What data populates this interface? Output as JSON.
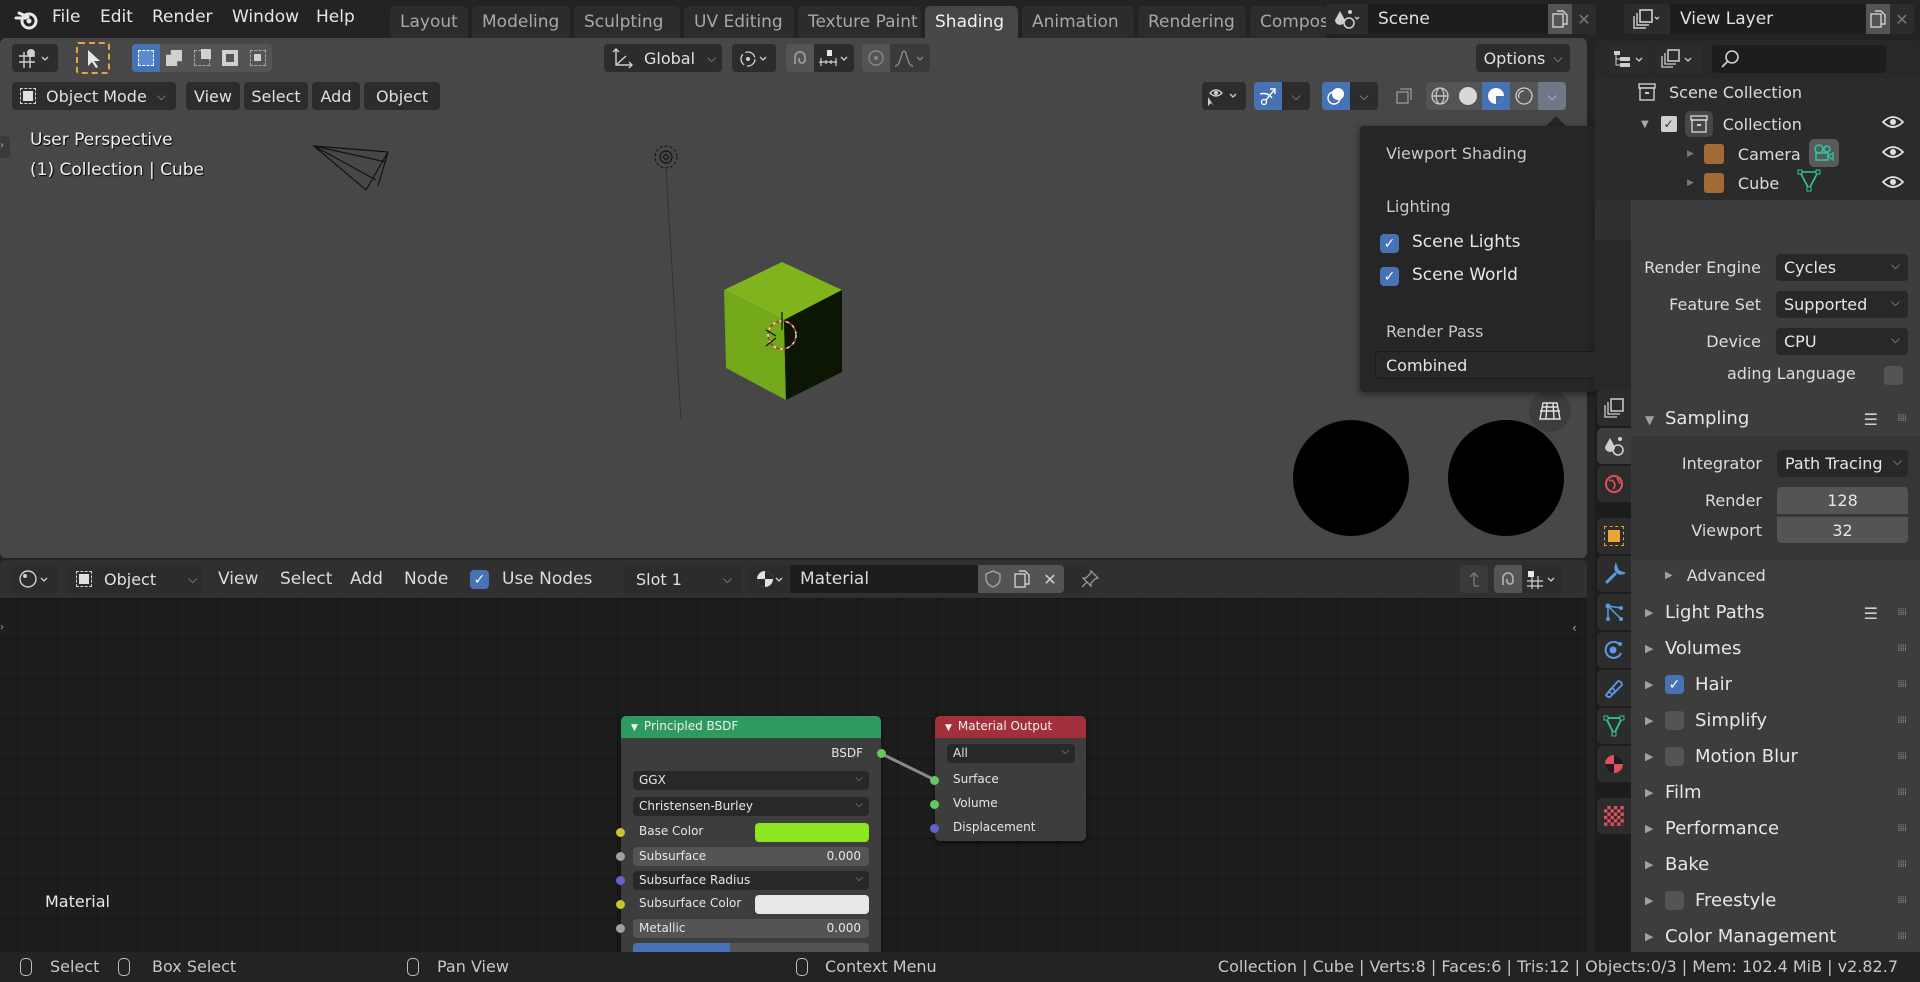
{
  "menubar": {
    "items": [
      "File",
      "Edit",
      "Render",
      "Window",
      "Help"
    ]
  },
  "workspaces": {
    "tabs": [
      "Layout",
      "Modeling",
      "Sculpting",
      "UV Editing",
      "Texture Paint",
      "Shading",
      "Animation",
      "Rendering",
      "Compos"
    ],
    "active": "Shading"
  },
  "scene_selector": {
    "icon": "scene-icon",
    "value": "Scene"
  },
  "viewlayer_selector": {
    "icon": "view-layer-icon",
    "value": "View Layer"
  },
  "tool_header": {
    "transform_orientation": "Global",
    "options_label": "Options"
  },
  "viewport_header": {
    "mode": "Object Mode",
    "menus": [
      "View",
      "Select",
      "Add",
      "Object"
    ]
  },
  "viewport": {
    "perspective_label": "User Perspective",
    "object_label": "(1) Collection | Cube",
    "cube_color": "#7fb41c"
  },
  "shading_popover": {
    "title": "Viewport Shading",
    "lighting_label": "Lighting",
    "scene_lights": {
      "label": "Scene Lights",
      "checked": true
    },
    "scene_world": {
      "label": "Scene World",
      "checked": true
    },
    "render_pass_label": "Render Pass",
    "render_pass_value": "Combined"
  },
  "node_header": {
    "editor_type": "Object",
    "menus": [
      "View",
      "Select",
      "Add",
      "Node"
    ],
    "use_nodes": {
      "label": "Use Nodes",
      "checked": true
    },
    "slot": "Slot 1",
    "material_name": "Material"
  },
  "node_editor": {
    "context_label": "Material",
    "principled": {
      "title": "Principled BSDF",
      "header_color": "#2e9a5f",
      "output": "BSDF",
      "distribution": "GGX",
      "subsurface_method": "Christensen-Burley",
      "inputs": [
        {
          "label": "Base Color",
          "type": "color",
          "color": "#8de61f"
        },
        {
          "label": "Subsurface",
          "type": "slider",
          "value": "0.000"
        },
        {
          "label": "Subsurface Radius",
          "type": "dropdown"
        },
        {
          "label": "Subsurface Color",
          "type": "color",
          "color": "#e8e8e8"
        },
        {
          "label": "Metallic",
          "type": "slider",
          "value": "0.000"
        }
      ]
    },
    "material_output": {
      "title": "Material Output",
      "header_color": "#a2303a",
      "target": "All",
      "inputs": [
        "Surface",
        "Volume",
        "Displacement"
      ]
    }
  },
  "outliner": {
    "root": "Scene Collection",
    "items": [
      {
        "label": "Collection",
        "visible": true
      },
      {
        "label": "Camera",
        "visible": true
      },
      {
        "label": "Cube",
        "visible": true
      }
    ]
  },
  "properties": {
    "context": "Scene",
    "render_engine": {
      "label": "Render Engine",
      "value": "Cycles"
    },
    "feature_set": {
      "label": "Feature Set",
      "value": "Supported"
    },
    "device": {
      "label": "Device",
      "value": "CPU"
    },
    "osl": {
      "label": "Open Shading Language",
      "visible_label": "ading Language",
      "checked": false
    },
    "sampling": {
      "title": "Sampling",
      "integrator": {
        "label": "Integrator",
        "value": "Path Tracing"
      },
      "render": {
        "label": "Render",
        "value": "128"
      },
      "viewport": {
        "label": "Viewport",
        "value": "32"
      },
      "advanced": "Advanced"
    },
    "panels": [
      {
        "title": "Light Paths",
        "checkbox": null,
        "presets": true
      },
      {
        "title": "Volumes",
        "checkbox": null
      },
      {
        "title": "Hair",
        "checkbox": true
      },
      {
        "title": "Simplify",
        "checkbox": false
      },
      {
        "title": "Motion Blur",
        "checkbox": false
      },
      {
        "title": "Film",
        "checkbox": null
      },
      {
        "title": "Performance",
        "checkbox": null
      },
      {
        "title": "Bake",
        "checkbox": null
      },
      {
        "title": "Freestyle",
        "checkbox": false
      },
      {
        "title": "Color Management",
        "checkbox": null
      }
    ]
  },
  "statusbar": {
    "hints": [
      "Select",
      "Box Select",
      "Pan View",
      "Context Menu"
    ],
    "info": "Collection | Cube | Verts:8 | Faces:6 | Tris:12 | Objects:0/3 | Mem: 102.4 MiB | v2.82.7"
  }
}
